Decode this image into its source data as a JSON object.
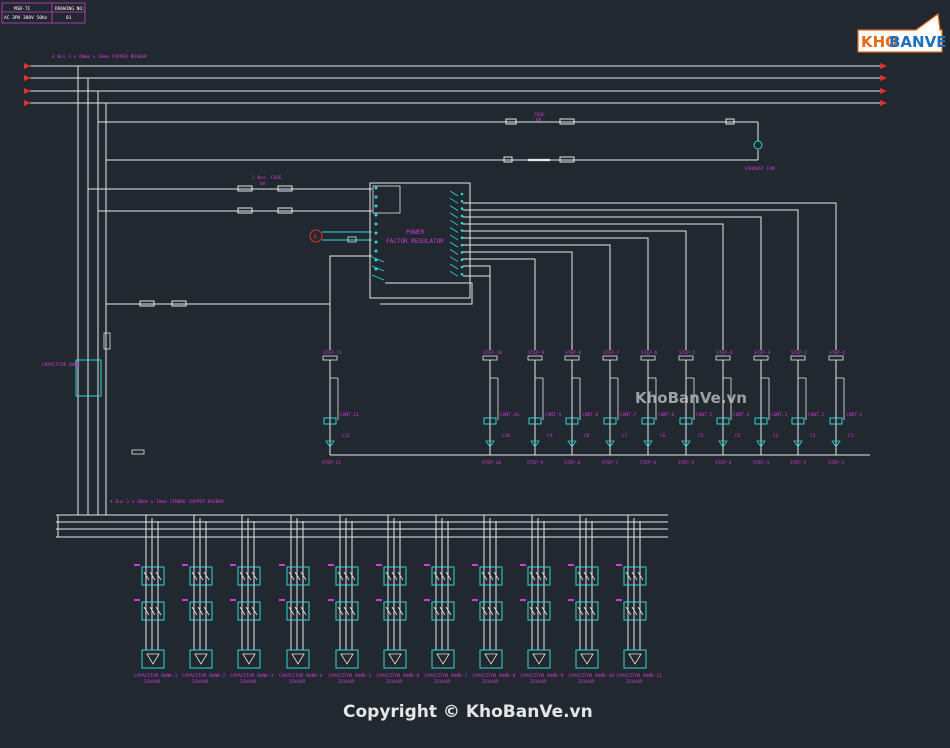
{
  "title_block": {
    "row1_left": "MSB-TI",
    "row1_right": "DRAWING NO:",
    "row2_left": "AC 3PH 380V 50Hz",
    "row2_right": "01"
  },
  "incoming_busbar_label": "4 Bus 3 x 60mm x 10mm COPPER BUSBAR",
  "fuse_top": {
    "label": "FUSE",
    "rating": "6A"
  },
  "exhaust_fan_label": "EXHAUST FAN",
  "fuse_mid": {
    "label": "2 Nos. FUSE",
    "rating": "6A"
  },
  "regulator": {
    "line1": "POWER",
    "line2": "FACTOR REGULATOR"
  },
  "ammeter_symbol": "A",
  "capacitor_bank_label": "CAPACITOR BANK",
  "bottom_busbar_label": "4 Bus 3 x 60mm x 10mm TINNED COPPER BUSBAR",
  "steps": [
    "STEP-11",
    "STEP-10",
    "STEP-9",
    "STEP-8",
    "STEP-7",
    "STEP-6",
    "STEP-5",
    "STEP-4",
    "STEP-3",
    "STEP-2",
    "STEP-1"
  ],
  "contactor_tags": [
    "C11",
    "C10",
    "C9",
    "C8",
    "C7",
    "C6",
    "C5",
    "C4",
    "C3",
    "C2",
    "C1"
  ],
  "cont_labels": [
    "CONT.11",
    "CONT.10",
    "CONT.9",
    "CONT.8",
    "CONT.7",
    "CONT.6",
    "CONT.5",
    "CONT.4",
    "CONT.3",
    "CONT.2",
    "CONT.1"
  ],
  "cap_banks": [
    "CAPACITOR BANK-1",
    "CAPACITOR BANK-2",
    "CAPACITOR BANK-3",
    "CAPACITOR BANK-4",
    "CAPACITOR BANK-5",
    "CAPACITOR BANK-6",
    "CAPACITOR BANK-7",
    "CAPACITOR BANK-8",
    "CAPACITOR BANK-9",
    "CAPACITOR BANK-10",
    "CAPACITOR BANK-11"
  ],
  "cap_ratings": [
    "25kVAR",
    "25kVAR",
    "25kVAR",
    "25kVAR",
    "25kVAR",
    "25kVAR",
    "25kVAR",
    "25kVAR",
    "25kVAR",
    "25kVAR",
    "25kVAR"
  ],
  "logo": {
    "part1": "KHO",
    "part2": "BANVE"
  },
  "watermark_center": "KhoBanVe.vn",
  "copyright": "Copyright © KhoBanVe.vn",
  "colors": {
    "wire": "#e8e8e8",
    "text": "#d23ad2",
    "cyan": "#2fd8d8",
    "arrow": "#e03030",
    "bg": "#212830"
  }
}
